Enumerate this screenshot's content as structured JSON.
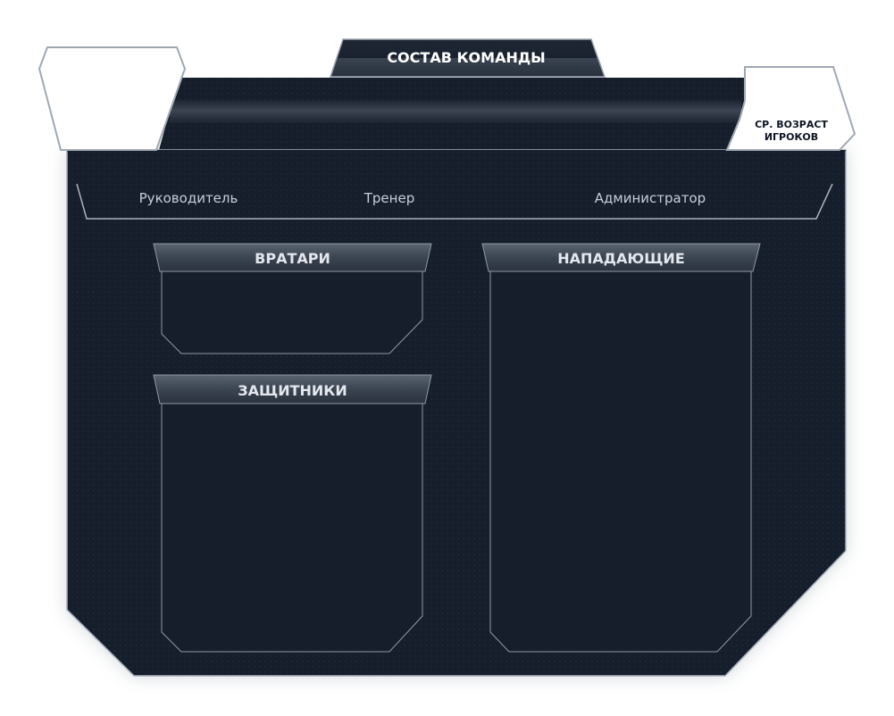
{
  "header": {
    "title": "СОСТАВ КОМАНДЫ",
    "team_logo": "team-logo-placeholder",
    "avg_age_label_line1": "СР. ВОЗРАСТ",
    "avg_age_label_line2": "ИГРОКОВ"
  },
  "staff": {
    "manager": "Руководитель",
    "coach": "Тренер",
    "administrator": "Администратор"
  },
  "sections": {
    "goalkeepers": "ВРАТАРИ",
    "defenders": "ЗАЩИТНИКИ",
    "forwards": "НАПАДАЮЩИЕ"
  },
  "colors": {
    "panel_bg": "#161e2b",
    "border": "#8f99a6",
    "header_bar": "#3a4350",
    "text_light": "#e4e8ee"
  }
}
